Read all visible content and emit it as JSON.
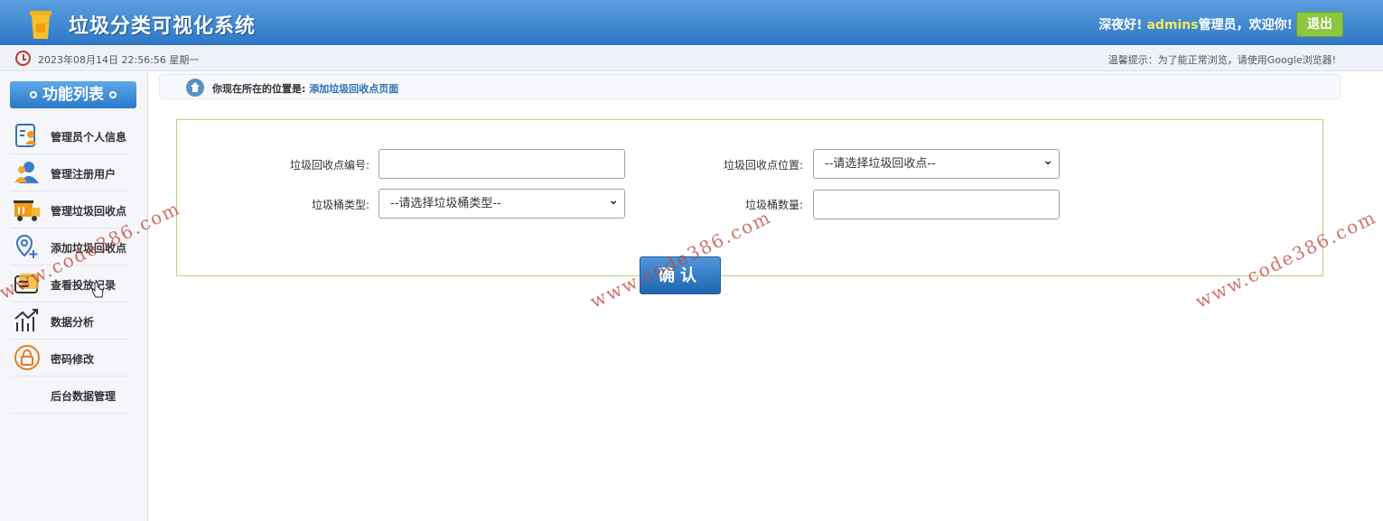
{
  "header": {
    "title": "垃圾分类可视化系统",
    "greeting_prefix": "深夜好!",
    "username": "admins",
    "greeting_suffix": "管理员，欢迎你!",
    "logout_label": "退出",
    "logo_icon": "trash-bin-icon"
  },
  "infobar": {
    "datetime": "2023年08月14日 22:56:56 星期一",
    "tip": "温馨提示：为了能正常浏览，请使用Google浏览器!"
  },
  "sidebar": {
    "title": "功能列表",
    "items": [
      {
        "label": "管理员个人信息",
        "icon": "admin-profile-icon"
      },
      {
        "label": "管理注册用户",
        "icon": "users-icon"
      },
      {
        "label": "管理垃圾回收点",
        "icon": "truck-icon"
      },
      {
        "label": "添加垃圾回收点",
        "icon": "add-location-icon"
      },
      {
        "label": "查看投放记录",
        "icon": "records-icon"
      },
      {
        "label": "数据分析",
        "icon": "chart-icon"
      },
      {
        "label": "密码修改",
        "icon": "lock-icon"
      },
      {
        "label": "后台数据管理",
        "icon": ""
      }
    ]
  },
  "breadcrumb": {
    "prefix": "你现在所在的位置是:",
    "current": "添加垃圾回收点页面"
  },
  "form": {
    "point_id_label": "垃圾回收点编号:",
    "point_id_value": "",
    "location_label": "垃圾回收点位置:",
    "location_selected": "--请选择垃圾回收点--",
    "bin_type_label": "垃圾桶类型:",
    "bin_type_selected": "--请选择垃圾桶类型--",
    "bin_count_label": "垃圾桶数量:",
    "bin_count_value": "",
    "confirm_label": "确认"
  },
  "watermark": "www.code386.com",
  "colors": {
    "header": "#3a85d2",
    "accent_green": "#8dc63f",
    "username": "#f5e95c",
    "form_border": "#b9d37a"
  }
}
